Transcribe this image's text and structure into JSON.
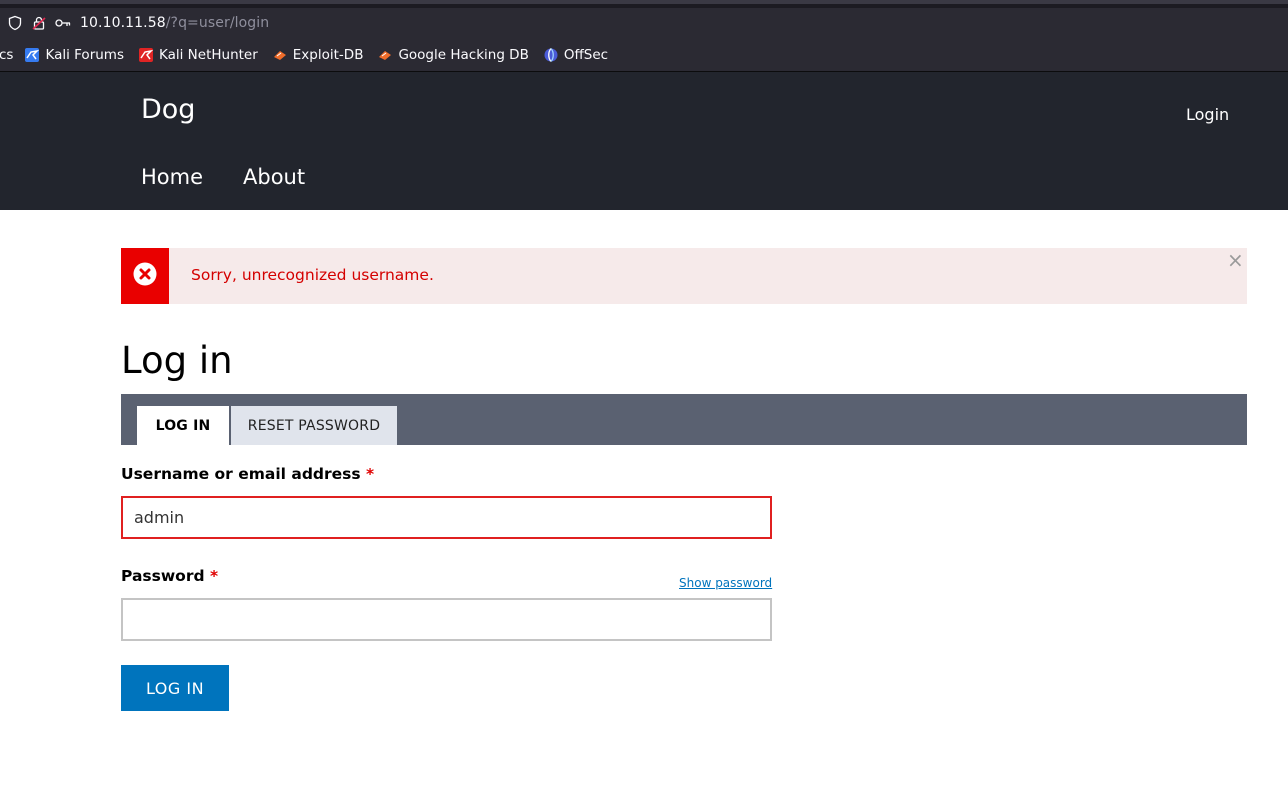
{
  "browser": {
    "url_host": "10.10.11.58",
    "url_path": "/?q=user/login",
    "bookmarks": [
      {
        "label": "cs"
      },
      {
        "label": "Kali Forums"
      },
      {
        "label": "Kali NetHunter"
      },
      {
        "label": "Exploit-DB"
      },
      {
        "label": "Google Hacking DB"
      },
      {
        "label": "OffSec"
      }
    ]
  },
  "header": {
    "site_name": "Dog",
    "login_link": "Login",
    "nav": [
      {
        "label": "Home"
      },
      {
        "label": "About"
      }
    ]
  },
  "message": {
    "text": "Sorry, unrecognized username.",
    "close": "×",
    "color": "#e90000"
  },
  "page": {
    "title": "Log in",
    "tabs": [
      {
        "label": "LOG IN",
        "active": true
      },
      {
        "label": "RESET PASSWORD",
        "active": false
      }
    ]
  },
  "form": {
    "username_label": "Username or email address",
    "username_value": "admin",
    "password_label": "Password",
    "password_value": "",
    "required_mark": "*",
    "show_password": "Show password",
    "submit_label": "LOG IN"
  },
  "colors": {
    "header_bg": "#22252d",
    "accent": "#0074bd",
    "error": "#e02020"
  }
}
